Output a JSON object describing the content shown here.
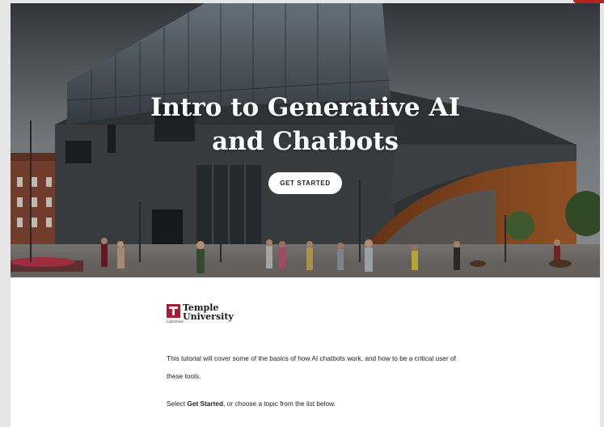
{
  "hero": {
    "title_line1": "Intro to Generative AI",
    "title_line2": "and Chatbots",
    "cta_label": "GET STARTED"
  },
  "logo": {
    "word1": "Temple",
    "word2": "University",
    "sub": "Libraries"
  },
  "content": {
    "intro_text": "This tutorial will cover some of the basics of how AI chatbots work, and how to be a critical user of these tools.",
    "instruction_prefix": "Select ",
    "instruction_bold": "Get Started",
    "instruction_suffix": ", or choose a topic from the list below."
  },
  "colors": {
    "brand": "#a41e35",
    "cta_bg": "#ffffff",
    "corner_accent": "#b3261e"
  }
}
